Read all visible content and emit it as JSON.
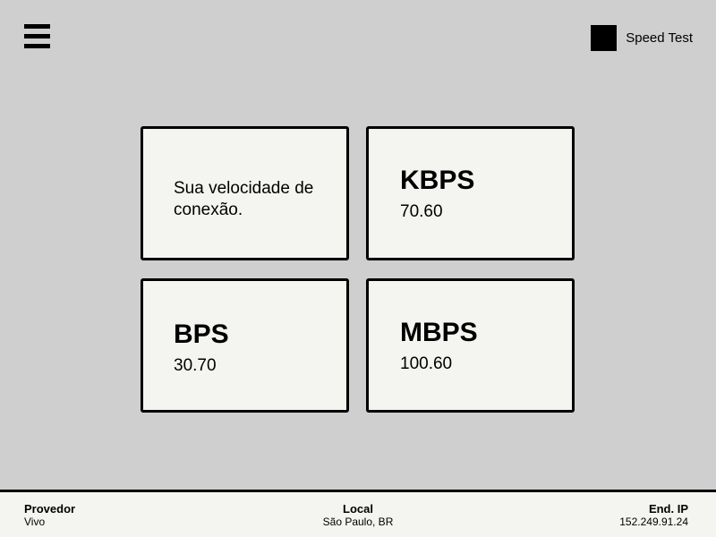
{
  "header": {
    "menu_icon": "hamburger-menu-icon",
    "brand_logo": "square-logo",
    "app_title": "Speed Test"
  },
  "cards": {
    "intro": {
      "text": "Sua velocidade de conexão."
    },
    "kbps": {
      "unit": "KBPS",
      "value": "70.60"
    },
    "bps": {
      "unit": "BPS",
      "value": "30.70"
    },
    "mbps": {
      "unit": "MBPS",
      "value": "100.60"
    }
  },
  "footer": {
    "provider": {
      "label": "Provedor",
      "value": "Vivo"
    },
    "location": {
      "label": "Local",
      "value": "São Paulo, BR"
    },
    "ip": {
      "label": "End. IP",
      "value": "152.249.91.24"
    }
  },
  "colors": {
    "background": "#cfcfcf",
    "card": "#f4f4f0",
    "border": "#000000"
  }
}
